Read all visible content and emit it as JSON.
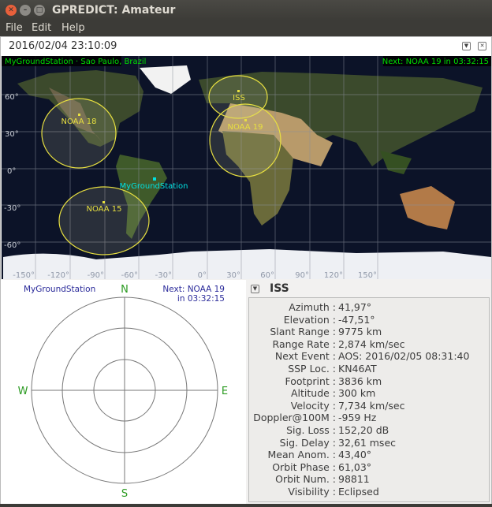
{
  "window": {
    "title": "GPREDICT: Amateur"
  },
  "menu": [
    "File",
    "Edit",
    "Help"
  ],
  "module": {
    "datetime": "2016/02/04 23:10:09"
  },
  "map": {
    "station_header": "MyGroundStation · Sao Paulo, Brazil",
    "next_event": "Next: NOAA 19 in 03:32:15",
    "lat_labels": [
      "60°",
      "30°",
      "0°",
      "-30°",
      "-60°"
    ],
    "lon_labels": [
      "-150°",
      "-120°",
      "-90°",
      "-60°",
      "-30°",
      "0°",
      "30°",
      "60°",
      "90°",
      "120°",
      "150°"
    ],
    "ground_station": "MyGroundStation",
    "satellites": [
      "NOAA 18",
      "ISS",
      "NOAA 19",
      "NOAA 15"
    ],
    "colors": {
      "footprint": "#e8e040",
      "station": "#00e0e0",
      "header": "#00e000"
    }
  },
  "polar": {
    "station": "MyGroundStation",
    "next_line1": "Next: NOAA 19",
    "next_line2": "in 03:32:15",
    "n": "N",
    "s": "S",
    "e": "E",
    "w": "W"
  },
  "info": {
    "title": "ISS",
    "rows": [
      {
        "k": "Azimuth :",
        "v": " 41,97°"
      },
      {
        "k": "Elevation :",
        "v": "-47,51°"
      },
      {
        "k": "Slant Range :",
        "v": "9775 km"
      },
      {
        "k": "Range Rate :",
        "v": "2,874 km/sec"
      },
      {
        "k": "Next Event :",
        "v": "AOS: 2016/02/05 08:31:40"
      },
      {
        "k": "SSP Loc. :",
        "v": "KN46AT"
      },
      {
        "k": "Footprint :",
        "v": "3836 km"
      },
      {
        "k": "Altitude :",
        "v": "300 km"
      },
      {
        "k": "Velocity :",
        "v": "7,734 km/sec"
      },
      {
        "k": "Doppler@100M :",
        "v": "-959 Hz"
      },
      {
        "k": "Sig. Loss :",
        "v": "152,20 dB"
      },
      {
        "k": "Sig. Delay :",
        "v": "32,61 msec"
      },
      {
        "k": "Mean Anom. :",
        "v": "43,40°"
      },
      {
        "k": "Orbit Phase :",
        "v": "61,03°"
      },
      {
        "k": "Orbit Num. :",
        "v": "98811"
      },
      {
        "k": "Visibility :",
        "v": "Eclipsed"
      }
    ]
  }
}
